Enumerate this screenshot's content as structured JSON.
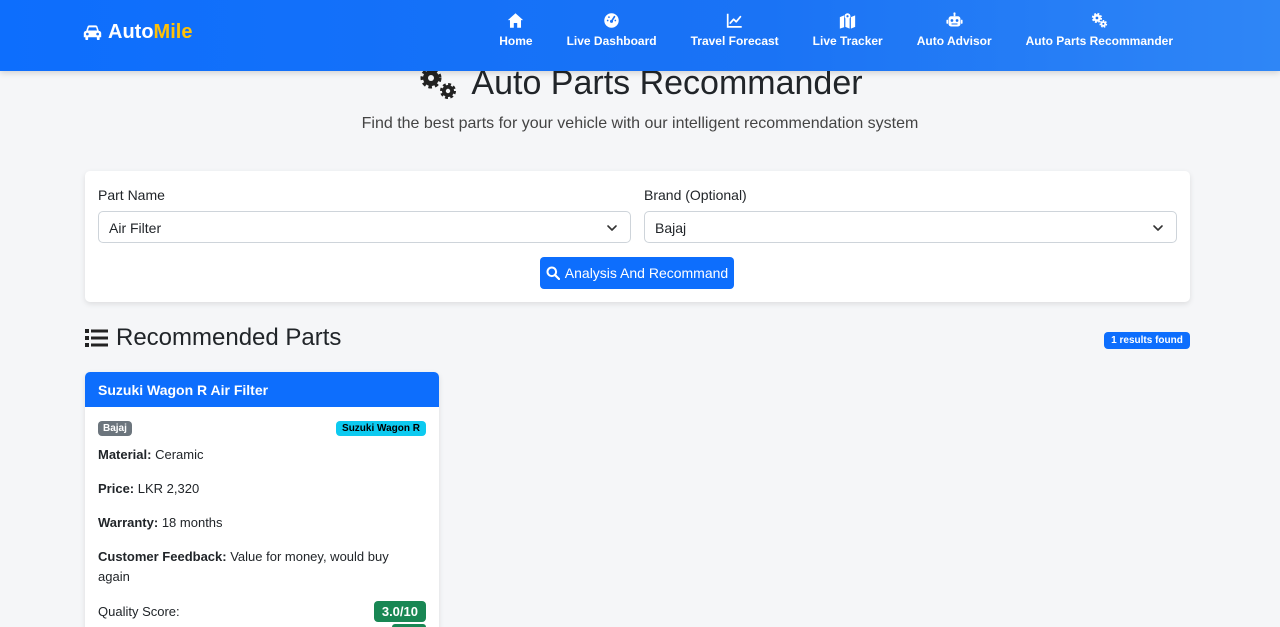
{
  "brand": {
    "name_part1": "Auto",
    "name_part2": "Mile"
  },
  "nav": {
    "items": [
      {
        "label": "Home",
        "icon": "home-icon"
      },
      {
        "label": "Live Dashboard",
        "icon": "dashboard-gauge-icon"
      },
      {
        "label": "Travel Forecast",
        "icon": "chart-line-icon"
      },
      {
        "label": "Live Tracker",
        "icon": "map-icon"
      },
      {
        "label": "Auto Advisor",
        "icon": "robot-icon"
      },
      {
        "label": "Auto Parts Recommander",
        "icon": "gears-icon"
      }
    ]
  },
  "header": {
    "title": "Auto Parts Recommander",
    "subtitle": "Find the best parts for your vehicle with our intelligent recommendation system"
  },
  "form": {
    "part_label": "Part Name",
    "part_value": "Air Filter",
    "brand_label": "Brand (Optional)",
    "brand_value": "Bajaj",
    "submit_label": "Analysis And Recommand"
  },
  "results": {
    "title": "Recommended Parts",
    "count_label": "1 results found",
    "items": [
      {
        "name": "Suzuki Wagon R Air Filter",
        "brand": "Bajaj",
        "model": "Suzuki Wagon R",
        "material_label": "Material:",
        "material": "Ceramic",
        "price_label": "Price:",
        "price": "LKR 2,320",
        "warranty_label": "Warranty:",
        "warranty": "18 months",
        "feedback_label": "Customer Feedback:",
        "feedback": "Value for money, would buy again",
        "quality_label": "Quality Score:",
        "quality_score": "3.0/10"
      }
    ]
  },
  "colors": {
    "primary": "#0d6efd",
    "accent": "#ffc107",
    "success": "#198754",
    "info": "#0dcaf0",
    "secondary": "#6c757d"
  }
}
